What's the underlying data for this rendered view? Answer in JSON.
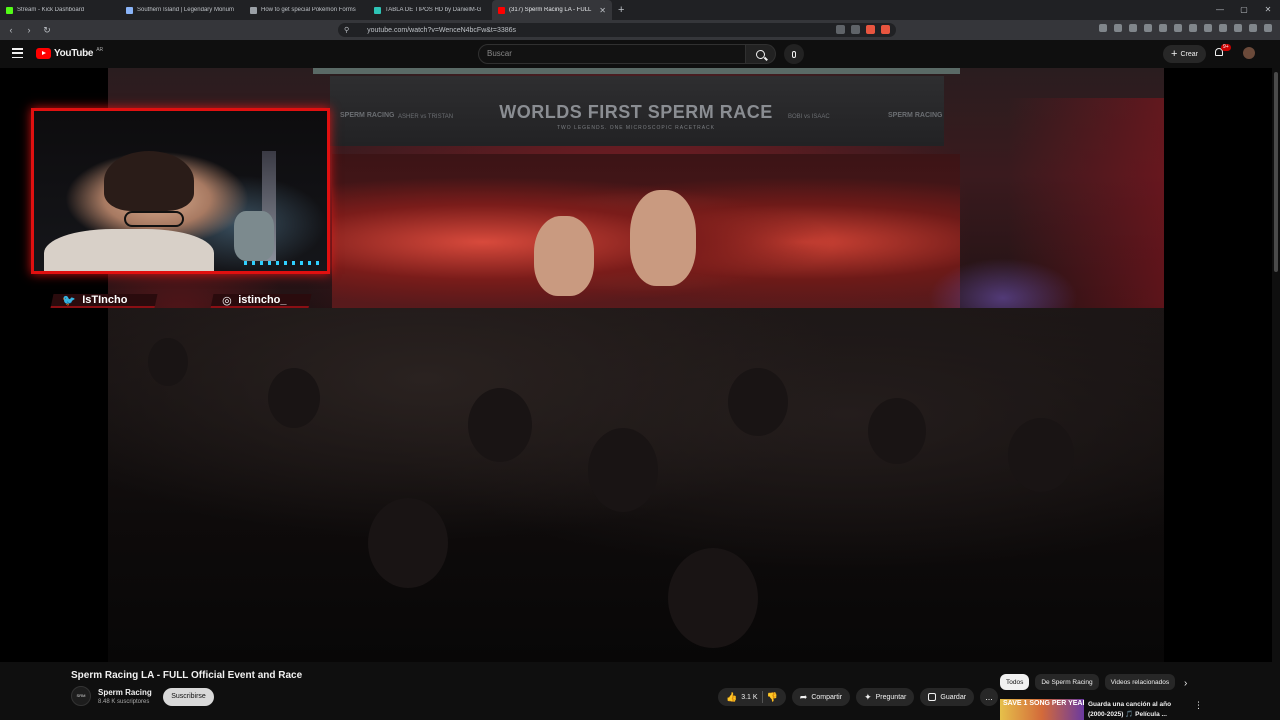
{
  "browser": {
    "tabs": [
      {
        "title": "Stream - Kick Dashboard",
        "color": "#53fc18",
        "active": false
      },
      {
        "title": "Southern Island | Legendary Monum",
        "color": "#8ab4f8",
        "active": false
      },
      {
        "title": "How to get special Pokémon Forms",
        "color": "#9aa0a6",
        "active": false
      },
      {
        "title": "TABLA DE TIPOS HD by DanielM-G",
        "color": "#2ec4b6",
        "active": false
      },
      {
        "title": "(317) Sperm Racing LA - FULL",
        "color": "#ff0000",
        "active": true
      }
    ],
    "url": "youtube.com/watch?v=WenceN4bcFw&t=3386s"
  },
  "youtube": {
    "logo_text": "YouTube",
    "country_code": "AR",
    "search_placeholder": "Buscar",
    "create_label": "Crear",
    "notification_count": "9+"
  },
  "video": {
    "banner_title": "WORLDS FIRST SPERM RACE",
    "banner_subtitle": "TWO LEGENDS. ONE MICROSCOPIC RACETRACK",
    "banner_left_logo": "SPERM RACING",
    "banner_right_logo": "SPERM RACING",
    "banner_left_matchup": "ASHER vs TRISTAN",
    "banner_right_matchup": "BOBI vs ISAAC"
  },
  "overlay": {
    "twitter_handle": "IsTIncho",
    "instagram_handle": "istincho_"
  },
  "watch": {
    "title": "Sperm Racing LA - FULL Official Event and Race",
    "channel_name": "Sperm Racing",
    "channel_avatar_text": "SRM",
    "subscribers": "8.48 K suscriptores",
    "subscribe_label": "Suscribirse",
    "likes": "3.1 K",
    "share_label": "Compartir",
    "ask_label": "Preguntar",
    "save_label": "Guardar",
    "more_label": "..."
  },
  "sidebar": {
    "chips": [
      {
        "label": "Todos",
        "selected": true
      },
      {
        "label": "De Sperm Racing",
        "selected": false
      },
      {
        "label": "Videos relacionados",
        "selected": false
      }
    ],
    "recommendation": {
      "thumb_text": "SAVE 1 SONG PER YEAR",
      "title": "Guarda una canción al año (2000-2025) 🎵 Película ..."
    }
  }
}
